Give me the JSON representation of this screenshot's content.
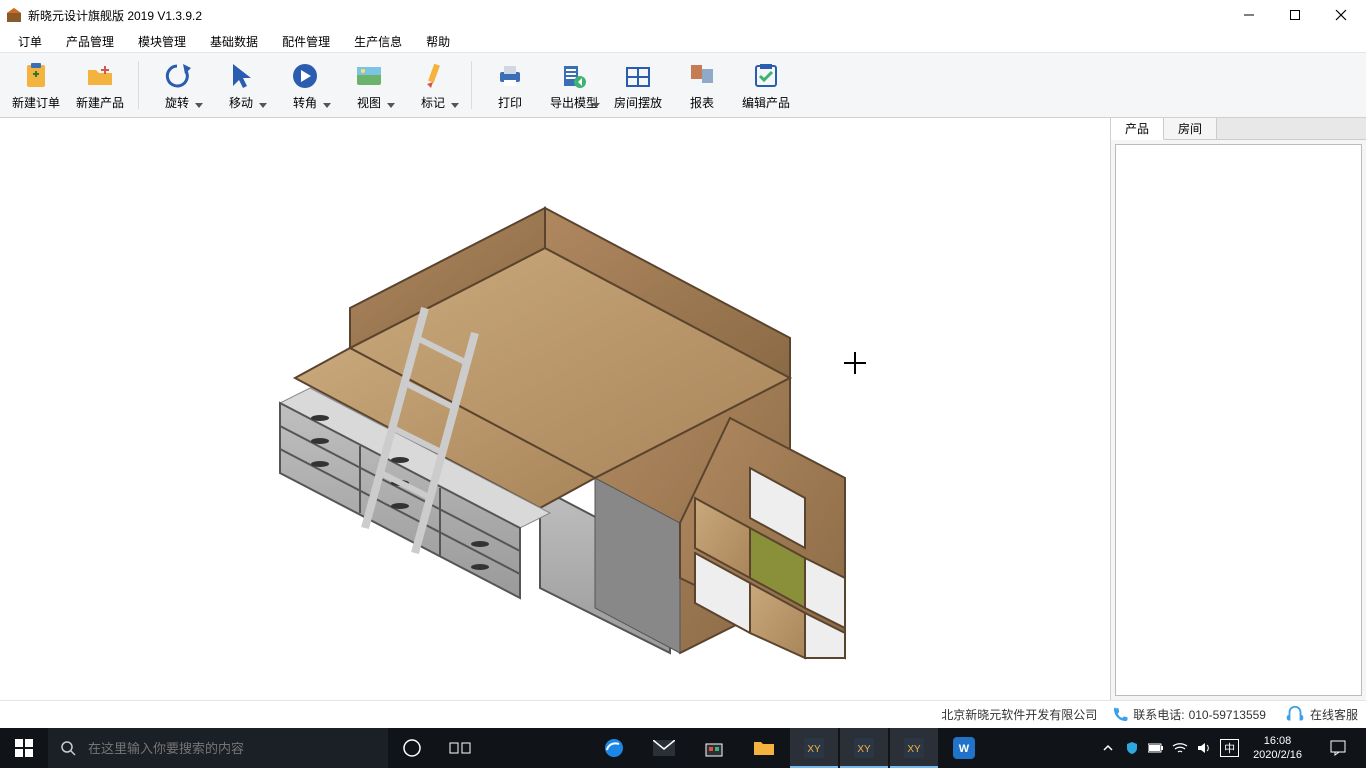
{
  "title": "新晓元设计旗舰版 2019 V1.3.9.2",
  "menus": {
    "order": "订单",
    "product_mgmt": "产品管理",
    "module_mgmt": "模块管理",
    "base_data": "基础数据",
    "parts_mgmt": "配件管理",
    "prod_info": "生产信息",
    "help": "帮助"
  },
  "toolbar": {
    "new_order": "新建订单",
    "new_product": "新建产品",
    "rotate": "旋转",
    "move": "移动",
    "corner": "转角",
    "view": "视图",
    "mark": "标记",
    "print": "打印",
    "export_model": "导出模型",
    "room_layout": "房间摆放",
    "report": "报表",
    "edit_product": "编辑产品"
  },
  "side": {
    "tab_product": "产品",
    "tab_room": "房间"
  },
  "status": {
    "company": "北京新晓元软件开发有限公司",
    "contact_label": "联系电话:",
    "contact_phone": "010-59713559",
    "online_service": "在线客服"
  },
  "taskbar": {
    "search_placeholder": "在这里输入你要搜索的内容",
    "ime": "中",
    "time": "16:08",
    "date": "2020/2/16"
  }
}
